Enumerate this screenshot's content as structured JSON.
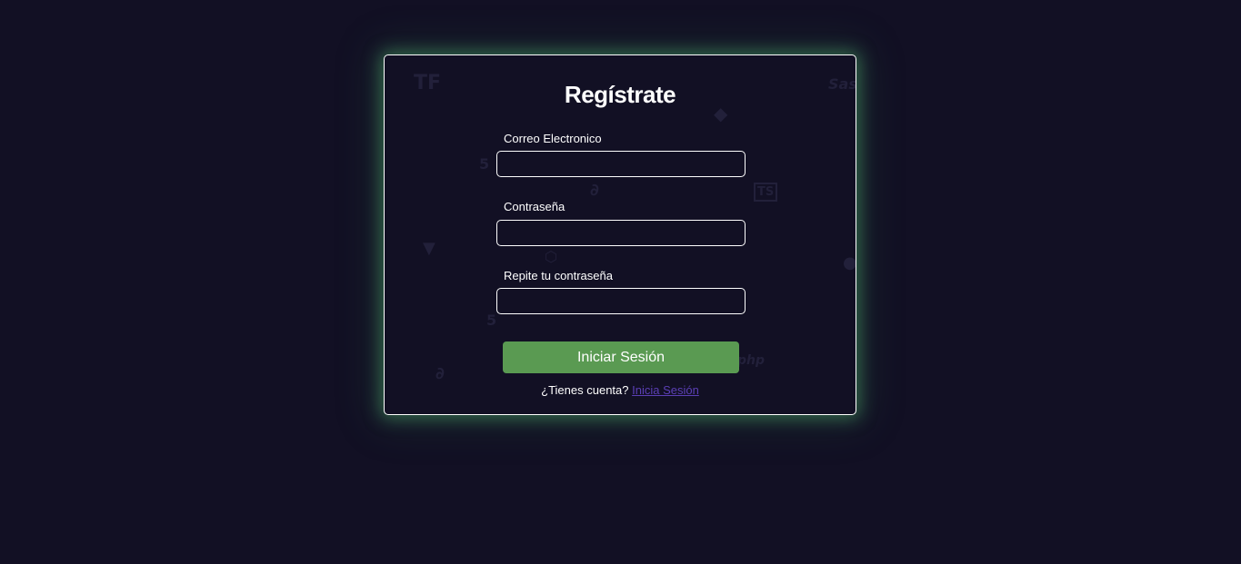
{
  "form": {
    "title": "Regístrate",
    "fields": [
      {
        "label": "Correo Electronico",
        "value": "",
        "placeholder": ""
      },
      {
        "label": "Contraseña",
        "value": "",
        "placeholder": ""
      },
      {
        "label": "Repite tu contraseña",
        "value": "",
        "placeholder": ""
      }
    ],
    "submit_label": "Iniciar Sesión",
    "footer_text": "¿Tienes cuenta?",
    "footer_link": "Inicia Sesión"
  },
  "background_icons": [
    "tensorflow-icon",
    "sass-icon",
    "git-icon",
    "html5-icon",
    "typescript-icon",
    "vue-icon",
    "mysql-icon",
    "nodejs-icon",
    "python-icon",
    "php-icon"
  ],
  "colors": {
    "background": "#121024",
    "card_glow": "#48a064",
    "button": "#5a9a52",
    "link": "#5b3fb5",
    "text": "#ffffff"
  }
}
